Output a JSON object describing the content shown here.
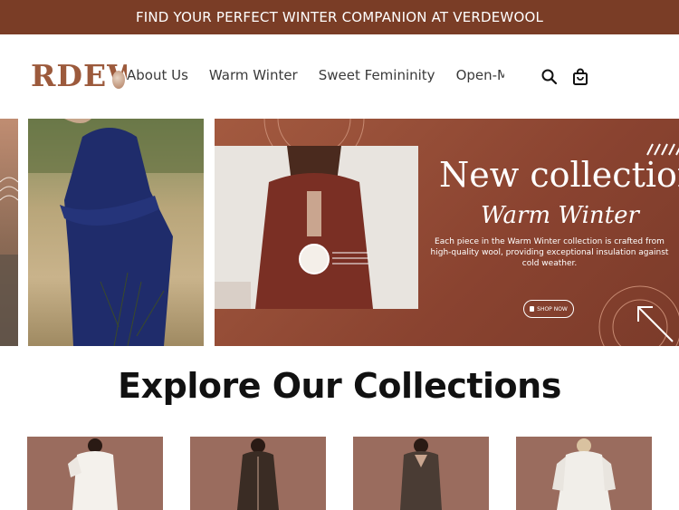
{
  "announcement": "FIND YOUR PERFECT WINTER COMPANION AT VERDEWOOL",
  "logo": {
    "text": "RDEW"
  },
  "nav": {
    "items": [
      {
        "label": "About Us"
      },
      {
        "label": "Warm Winter"
      },
      {
        "label": "Sweet Femininity"
      },
      {
        "label": "Open-M"
      }
    ]
  },
  "icons": {
    "search": "search-icon",
    "cart": "bag-icon"
  },
  "banner": {
    "title": "New collection",
    "subtitle": "Warm Winter",
    "description": "Each piece in the Warm Winter collection is crafted from high-quality wool, providing exceptional insulation against cold weather.",
    "button": "SHOP NOW"
  },
  "collections": {
    "title": "Explore Our Collections"
  },
  "colors": {
    "brand": "#7a3d26",
    "banner": "#8a4330",
    "card": "#9a6c5e"
  }
}
